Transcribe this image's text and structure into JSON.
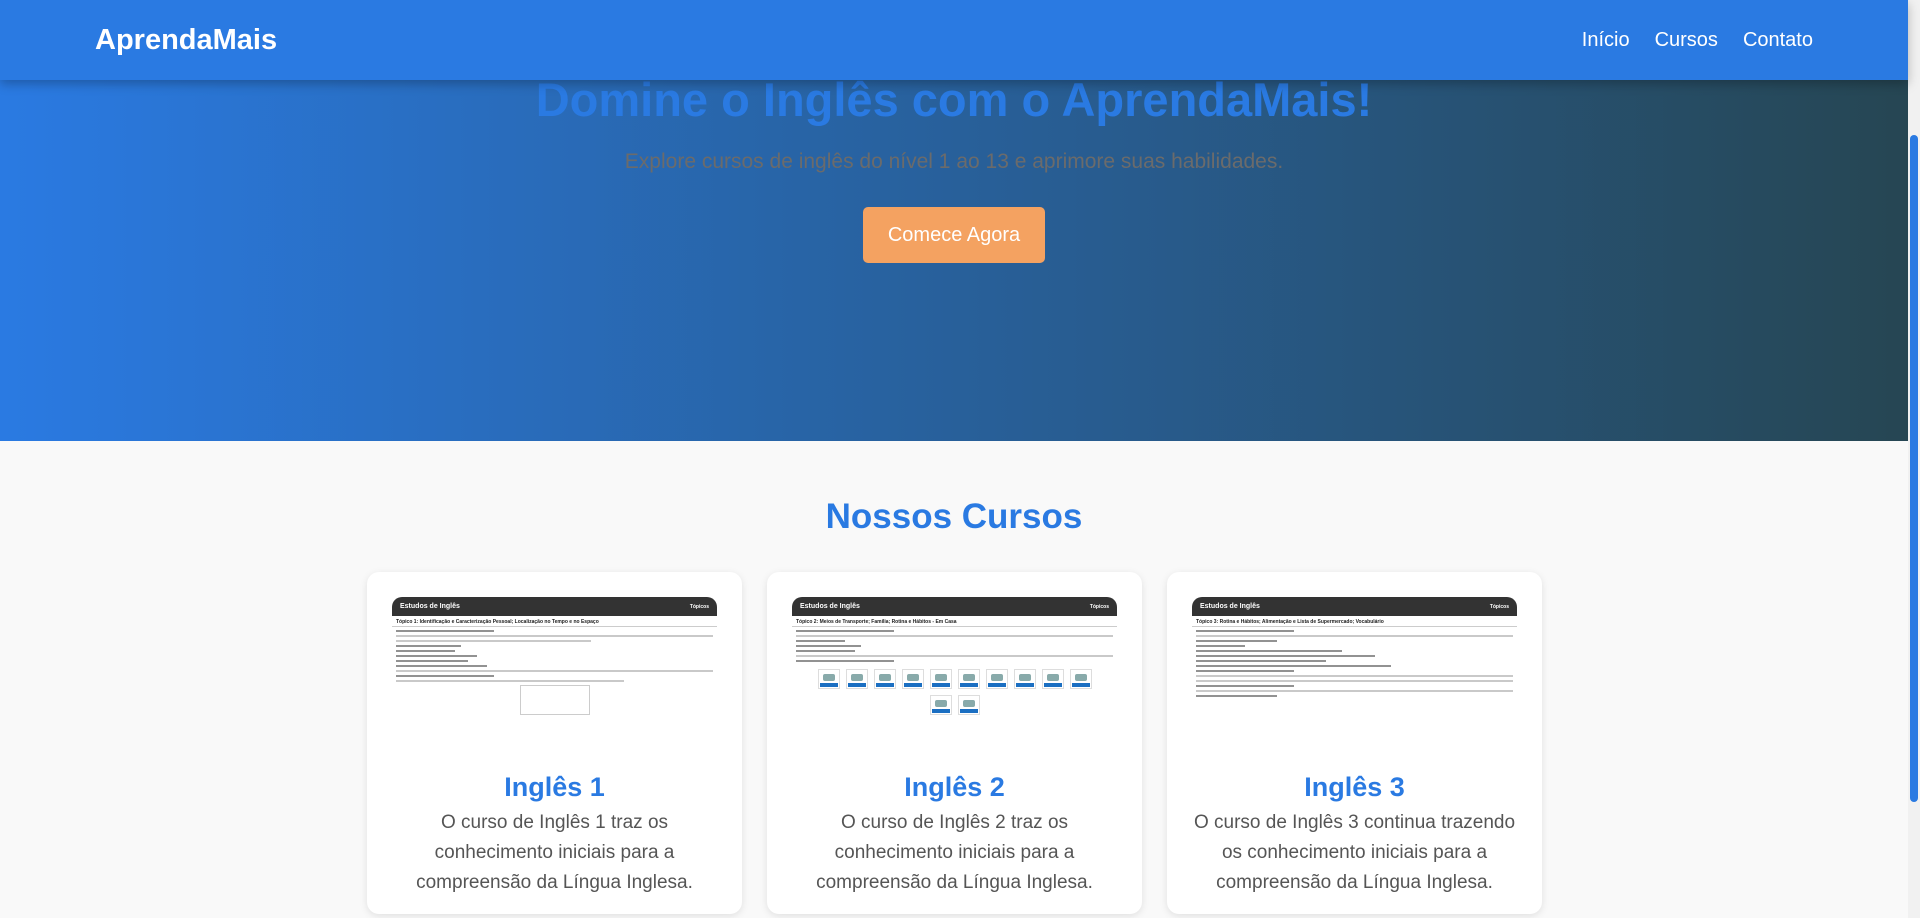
{
  "nav": {
    "logo": "AprendaMais",
    "links": [
      "Início",
      "Cursos",
      "Contato"
    ]
  },
  "hero": {
    "title": "Domine o Inglês com o AprendaMais!",
    "subtitle": "Explore cursos de inglês do nível 1 ao 13 e aprimore suas habilidades.",
    "cta": "Comece Agora"
  },
  "courses": {
    "title": "Nossos Cursos",
    "items": [
      {
        "title": "Inglês 1",
        "description": "O curso de Inglês 1 traz os conhecimento iniciais para a compreensão da Língua Inglesa.",
        "preview": {
          "header": "Estudos de Inglês",
          "menu": "Tópicos",
          "topic": "Tópico 1: Identificação e Caracterização Pessoal; Localização no Tempo e no Espaço"
        }
      },
      {
        "title": "Inglês 2",
        "description": "O curso de Inglês 2 traz os conhecimento iniciais para a compreensão da Língua Inglesa.",
        "preview": {
          "header": "Estudos de Inglês",
          "menu": "Tópicos",
          "topic": "Tópico 2: Meios de Transporte; Família; Rotina e Hábitos - Em Casa"
        }
      },
      {
        "title": "Inglês 3",
        "description": "O curso de Inglês 3 continua trazendo os conhecimento iniciais para a compreensão da Língua Inglesa.",
        "preview": {
          "header": "Estudos de Inglês",
          "menu": "Tópicos",
          "topic": "Tópico 3: Rotina e Hábitos; Alimentação e Lista de Supermercado; Vocabulário"
        }
      }
    ]
  },
  "colors": {
    "primary": "#2a7ae2",
    "hero_end": "#264653",
    "cta": "#f4a261"
  }
}
